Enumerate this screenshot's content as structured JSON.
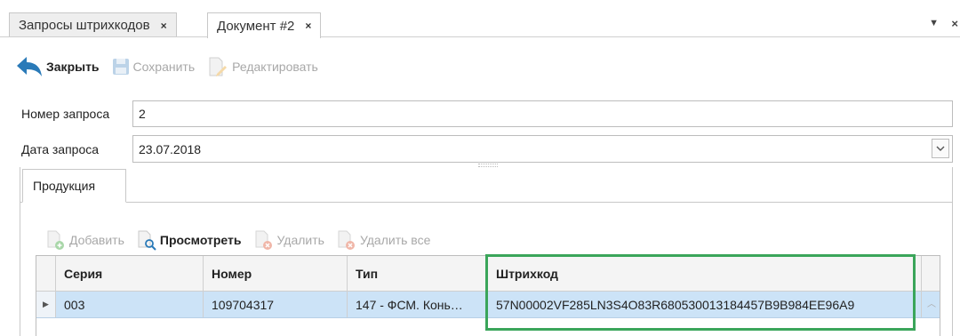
{
  "tabs": [
    {
      "label": "Запросы штрихкодов",
      "close": "×"
    },
    {
      "label": "Документ  #2",
      "close": "×"
    }
  ],
  "tabbar": {
    "menu_glyph": "▼",
    "close_glyph": "×"
  },
  "toolbar": {
    "close_label": "Закрыть",
    "save_label": "Сохранить",
    "edit_label": "Редактировать"
  },
  "form": {
    "request_number_label": "Номер запроса",
    "request_number_value": "2",
    "request_date_label": "Дата запроса",
    "request_date_value": "23.07.2018"
  },
  "inner_tab": {
    "label": "Продукция"
  },
  "subtoolbar": {
    "add_label": "Добавить",
    "view_label": "Просмотреть",
    "delete_label": "Удалить",
    "delete_all_label": "Удалить все"
  },
  "grid": {
    "columns": [
      "Серия",
      "Номер",
      "Тип",
      "Штрихкод"
    ],
    "rows": [
      {
        "series": "003",
        "number": "109704317",
        "type": "147 - ФСМ. Конь…",
        "barcode": "57N00002VF285LN3S4O83R680530013184457B9B984EE96A9"
      }
    ]
  },
  "colors": {
    "accent_highlight": "#3aa55a",
    "selected_row": "#cce3f7",
    "close_arrow": "#2a7ab8"
  }
}
